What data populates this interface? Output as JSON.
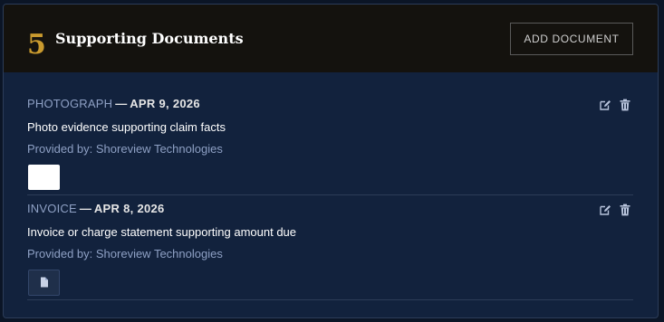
{
  "section": {
    "number": "5",
    "title": "Supporting Documents",
    "add_button_label": "ADD DOCUMENT"
  },
  "documents": [
    {
      "type": "PHOTOGRAPH",
      "separator": "—",
      "date": "APR 9, 2026",
      "description": "Photo evidence supporting claim facts",
      "provider": "Provided by: Shoreview Technologies",
      "thumbnail": "image-preview"
    },
    {
      "type": "INVOICE",
      "separator": "—",
      "date": "APR 8, 2026",
      "description": "Invoice or charge statement supporting amount due",
      "provider": "Provided by: Shoreview Technologies",
      "thumbnail": "file-icon"
    }
  ],
  "icons": {
    "edit": "edit-icon",
    "delete": "trash-icon"
  },
  "colors": {
    "accent_gold": "#c99a2e",
    "card_bg": "#12223d",
    "header_bg": "#14120e",
    "muted_text": "#8ea0c4"
  }
}
